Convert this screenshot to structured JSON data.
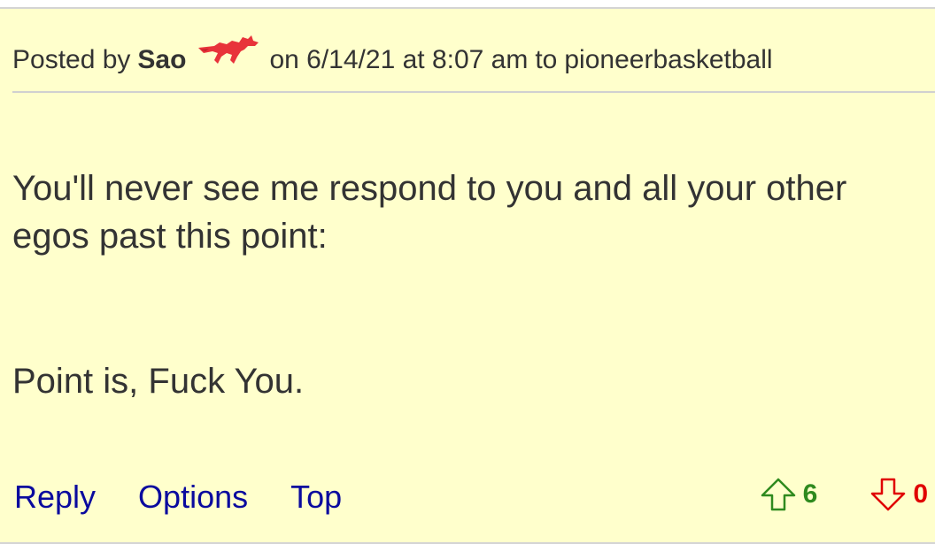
{
  "post": {
    "posted_by_label": "Posted by",
    "author": "Sao",
    "team_logo": "smu-mustang-logo",
    "date_label": "on 6/14/21 at 8:07 am",
    "to_label": "to",
    "reply_to_user": "pioneerbasketball",
    "paragraphs": [
      "You'll never see me respond to you and all your other egos past this point:",
      "Point is, Fuck You."
    ]
  },
  "actions": {
    "reply_label": "Reply",
    "options_label": "Options",
    "top_label": "Top"
  },
  "votes": {
    "upvotes": "6",
    "downvotes": "0",
    "up_icon": "arrow-up-outline-icon",
    "down_icon": "arrow-down-outline-icon"
  },
  "colors": {
    "post_background": "#ffffcc",
    "link": "#0a0a9e",
    "upvote": "#2f8a1e",
    "downvote": "#e00000",
    "logo": "#e8333a"
  }
}
